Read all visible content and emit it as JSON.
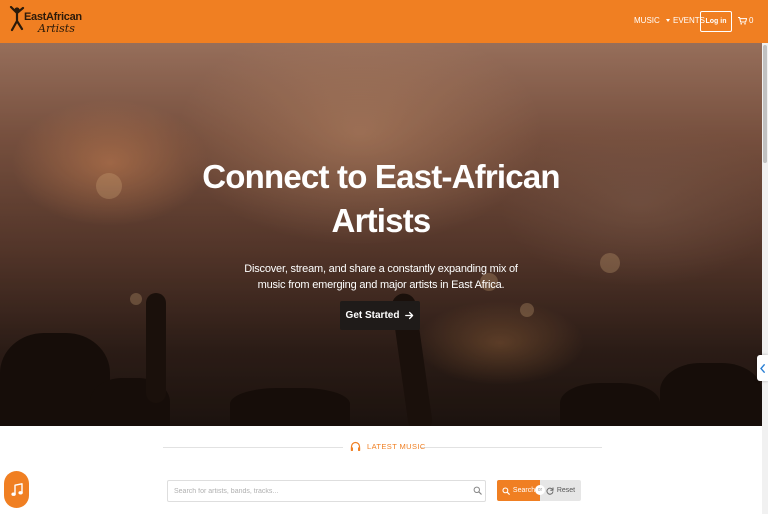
{
  "brand": {
    "line1": "EastAfrican",
    "line2": "Artists"
  },
  "nav": {
    "music_label": "MUSIC",
    "events_label": "EVENTS",
    "login_label": "Log in",
    "cart_count": "0"
  },
  "hero": {
    "title": "Connect to East-African Artists",
    "subtitle": "Discover, stream, and share a constantly expanding mix of music from emerging and major artists in East Africa.",
    "cta_label": "Get Started"
  },
  "latest": {
    "section_label": "LATEST MUSIC",
    "search_placeholder": "Search for artists, bands, tracks...",
    "search_label": "Search",
    "or_label": "or",
    "reset_label": "Reset"
  },
  "colors": {
    "accent": "#f07f22",
    "cta_bg": "#1f1b19"
  },
  "icons": {
    "cart": "cart-icon",
    "arrow": "arrow-right-icon",
    "headphones": "headphones-icon",
    "search": "search-icon",
    "refresh": "refresh-icon",
    "music_note": "music-note-icon",
    "chevron": "chevron-left-icon"
  }
}
